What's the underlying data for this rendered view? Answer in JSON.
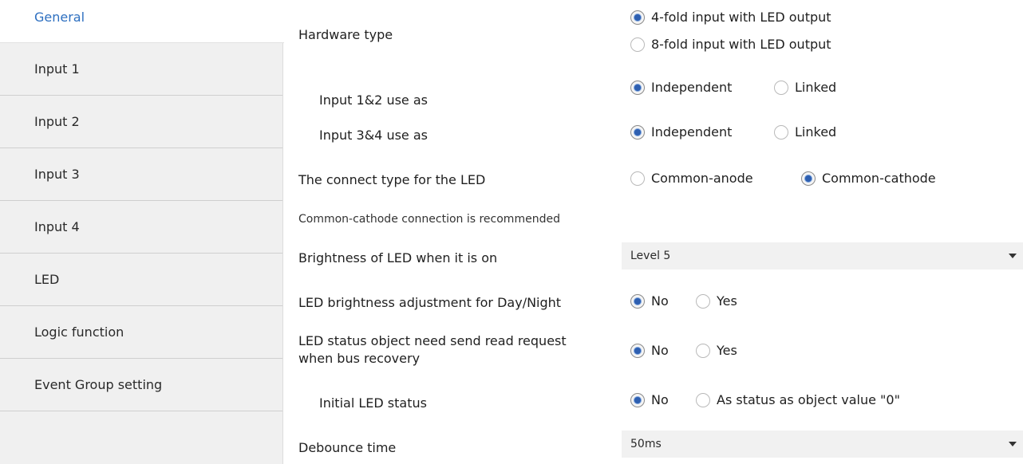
{
  "sidebar": {
    "items": [
      {
        "label": "General"
      },
      {
        "label": "Input 1"
      },
      {
        "label": "Input 2"
      },
      {
        "label": "Input 3"
      },
      {
        "label": "Input 4"
      },
      {
        "label": "LED"
      },
      {
        "label": "Logic function"
      },
      {
        "label": "Event Group setting"
      }
    ],
    "active": "General"
  },
  "main": {
    "hardware_type": {
      "label": "Hardware type",
      "options": [
        "4-fold input with LED output",
        "8-fold input with LED output"
      ],
      "selected": "4-fold input with LED output"
    },
    "input12": {
      "label": "Input 1&2 use as",
      "options": [
        "Independent",
        "Linked"
      ],
      "selected": "Independent"
    },
    "input34": {
      "label": "Input 3&4 use as",
      "options": [
        "Independent",
        "Linked"
      ],
      "selected": "Independent"
    },
    "connect_type": {
      "label": "The connect type for the LED",
      "options": [
        "Common-anode",
        "Common-cathode"
      ],
      "selected": "Common-cathode"
    },
    "note": "Common-cathode connection is recommended",
    "brightness": {
      "label": "Brightness of LED when it is on",
      "value": "Level 5"
    },
    "day_night": {
      "label": "LED brightness adjustment for Day/Night",
      "options": [
        "No",
        "Yes"
      ],
      "selected": "No"
    },
    "status_read": {
      "label_line1": "LED status object need send read request",
      "label_line2": "when bus recovery",
      "options": [
        "No",
        "Yes"
      ],
      "selected": "No"
    },
    "initial_status": {
      "label": "Initial LED status",
      "options": [
        "No",
        "As status as object value \"0\""
      ],
      "selected": "No"
    },
    "debounce": {
      "label": "Debounce time",
      "value": "50ms"
    }
  },
  "colors": {
    "sidebar_bg": "#f0f0f0",
    "active_text": "#2d6fc0",
    "radio_dot": "#2e5fb0",
    "select_bg": "#f1f1f1"
  }
}
